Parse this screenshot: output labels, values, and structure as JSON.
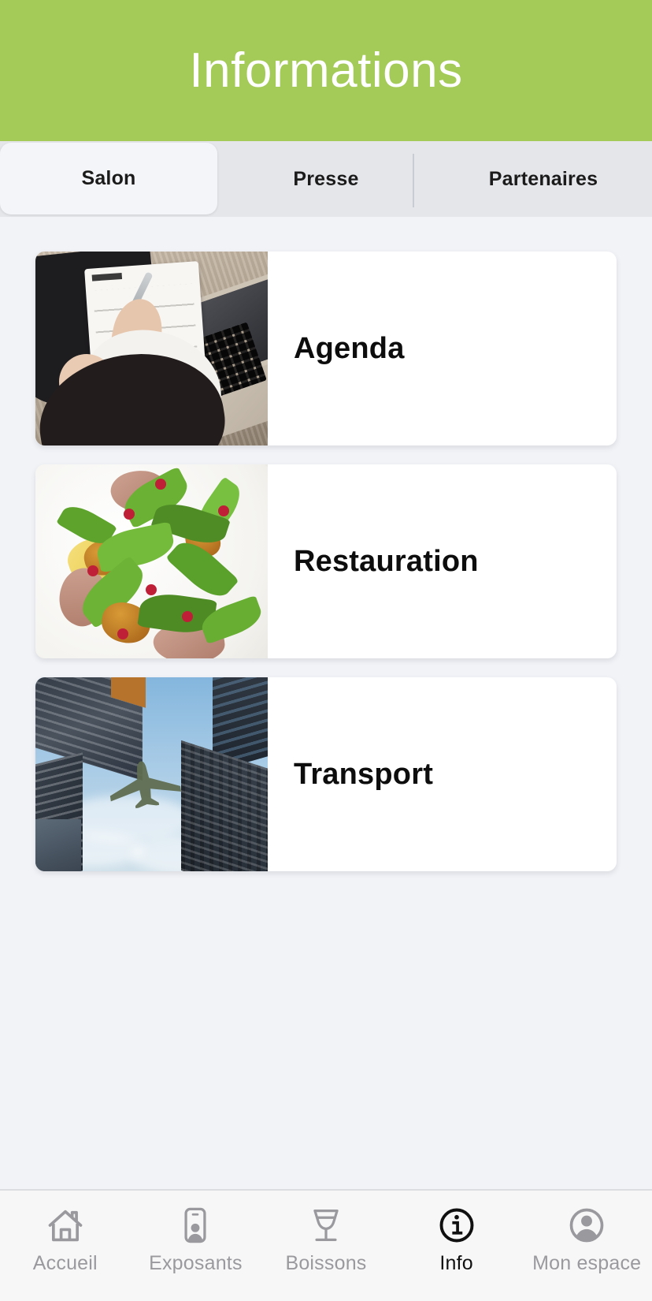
{
  "header": {
    "title": "Informations",
    "background_color": "#a4ca57",
    "text_color": "#ffffff"
  },
  "tabs": {
    "items": [
      {
        "label": "Salon",
        "active": true
      },
      {
        "label": "Presse",
        "active": false
      },
      {
        "label": "Partenaires",
        "active": false
      }
    ]
  },
  "cards": [
    {
      "label": "Agenda",
      "image": "planner-laptop-photo"
    },
    {
      "label": "Restauration",
      "image": "salad-plate-photo"
    },
    {
      "label": "Transport",
      "image": "airplane-skyscrapers-photo"
    }
  ],
  "bottom_nav": {
    "items": [
      {
        "label": "Accueil",
        "icon": "home-icon",
        "active": false
      },
      {
        "label": "Exposants",
        "icon": "badge-person-icon",
        "active": false
      },
      {
        "label": "Boissons",
        "icon": "wine-glass-icon",
        "active": false
      },
      {
        "label": "Info",
        "icon": "info-circle-icon",
        "active": true
      },
      {
        "label": "Mon espace",
        "icon": "account-circle-icon",
        "active": false
      }
    ],
    "inactive_color": "#9a9a9e",
    "active_color": "#101010"
  },
  "theme": {
    "page_background": "#f1f3f7",
    "card_background": "#ffffff",
    "tabstrip_background": "#e4e6ea",
    "active_tab_background": "#f4f5f8"
  }
}
